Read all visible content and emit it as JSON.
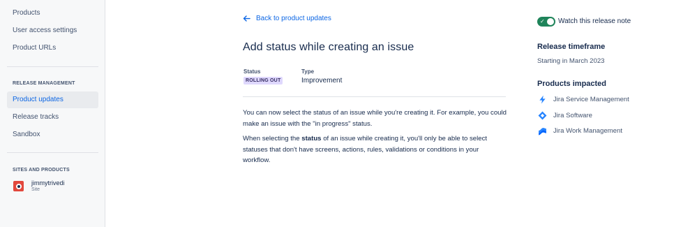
{
  "sidebar": {
    "items_top": [
      {
        "label": "Products"
      },
      {
        "label": "User access settings"
      },
      {
        "label": "Product URLs"
      }
    ],
    "release_section_label": "RELEASE MANAGEMENT",
    "release_items": [
      {
        "label": "Product updates",
        "active": true
      },
      {
        "label": "Release tracks"
      },
      {
        "label": "Sandbox"
      }
    ],
    "sites_section_label": "SITES AND PRODUCTS",
    "site": {
      "name": "jimmytrivedi",
      "type": "Site",
      "icon": "site-icon"
    }
  },
  "main": {
    "back_label": "Back to product updates",
    "title": "Add status while creating an issue",
    "status_label": "Status",
    "status_value": "ROLLING OUT",
    "type_label": "Type",
    "type_value": "Improvement",
    "paragraph1": "You can now select the status of an issue while you're creating it. For example, you could make an issue with the \"in progress\" status.",
    "paragraph2_before": "When selecting the ",
    "paragraph2_bold": "status",
    "paragraph2_after": " of an issue while creating it, you'll only be able to select statuses that don't have screens, actions, rules, validations or conditions in your workflow."
  },
  "panel": {
    "watch_label": "Watch this release note",
    "watch_on": true,
    "timeframe_heading": "Release timeframe",
    "timeframe_value": "Starting in March 2023",
    "products_heading": "Products impacted",
    "products": [
      {
        "label": "Jira Service Management",
        "icon": "jira-service-management-icon"
      },
      {
        "label": "Jira Software",
        "icon": "jira-software-icon"
      },
      {
        "label": "Jira Work Management",
        "icon": "jira-work-management-icon"
      }
    ]
  },
  "colors": {
    "accent": "#0c66e4",
    "toggle_on": "#1f845a",
    "status_badge_bg": "#dfd8fd",
    "product_icon_blue": "#2684ff"
  }
}
